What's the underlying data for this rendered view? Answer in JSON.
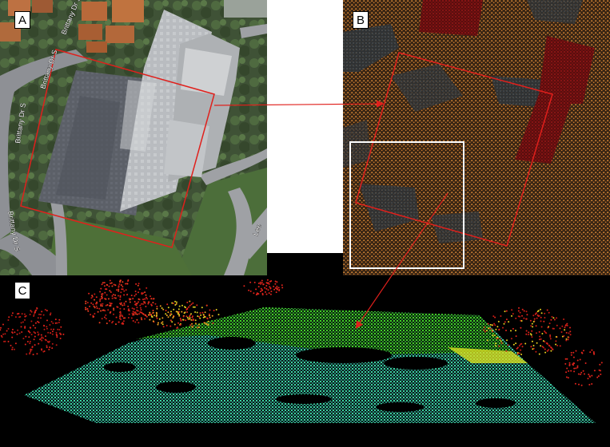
{
  "panels": {
    "a": {
      "label": "A"
    },
    "b": {
      "label": "B"
    },
    "c": {
      "label": "C"
    }
  },
  "street_labels": {
    "brittany_dr_s_1": "Brittany Dr S",
    "brittany_dr_s_2": "Brittany Dr S",
    "brittany_dr_s_3": "Brittany Dr S",
    "brittany_dr_s_4": "Brittany Dr S",
    "lee_partial": "Lee"
  },
  "colors": {
    "outline_red": "#e0201c",
    "zoom_box_white": "#ffffff",
    "lidar_ground_orange": "#e8923a",
    "lidar_building_red": "#9a1414",
    "cloud_green": "#3be33b",
    "cloud_cyan": "#2fd6c8",
    "cloud_red": "#e0241c"
  }
}
